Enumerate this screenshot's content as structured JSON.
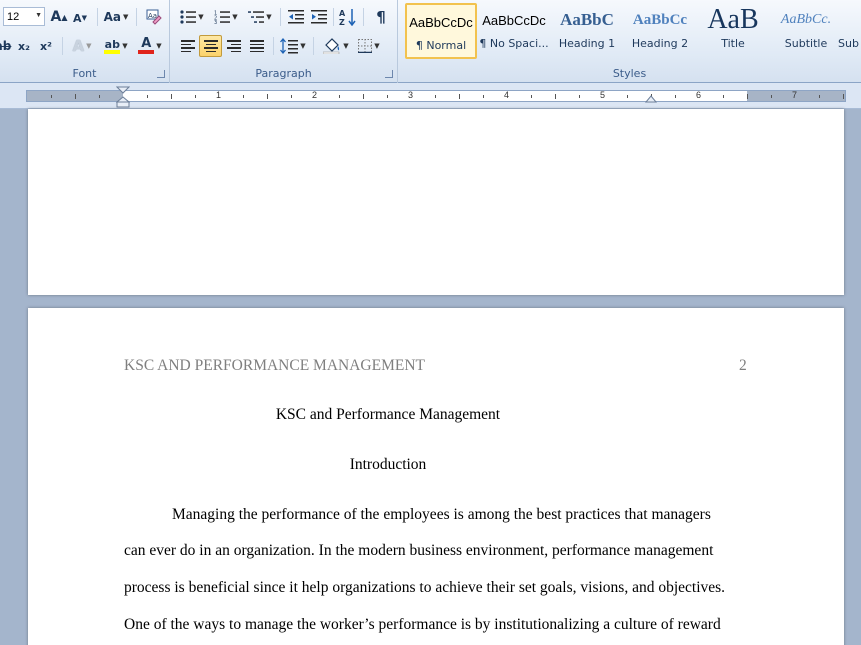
{
  "ribbon": {
    "font_group": {
      "label": "Font",
      "font_size": "12",
      "grow_label": "A",
      "shrink_label": "A",
      "change_case_label": "Aa",
      "subscript_label": "x₂",
      "superscript_label": "x²",
      "font_color_label": "A",
      "font_color": "#e0241b",
      "highlight_color": "#ffff00"
    },
    "paragraph_group": {
      "label": "Paragraph"
    },
    "styles_group": {
      "label": "Styles",
      "styles": [
        {
          "sample": "AaBbCcDc",
          "name": "¶ Normal",
          "selected": true
        },
        {
          "sample": "AaBbCcDc",
          "name": "¶ No Spaci...",
          "selected": false
        },
        {
          "sample": "AaBbC",
          "name": "Heading 1",
          "selected": false
        },
        {
          "sample": "AaBbCc",
          "name": "Heading 2",
          "selected": false
        },
        {
          "sample": "AaB",
          "name": "Title",
          "selected": false
        },
        {
          "sample": "AaBbCc.",
          "name": "Subtitle",
          "selected": false
        },
        {
          "sample": "",
          "name": "Sub",
          "selected": false
        }
      ]
    }
  },
  "ruler": {
    "numbers": [
      "1",
      "2",
      "3",
      "4",
      "5",
      "6",
      "7"
    ]
  },
  "document": {
    "running_head": "KSC AND PERFORMANCE MANAGEMENT",
    "page_number": "2",
    "title": "KSC and Performance Management",
    "heading": "Introduction",
    "paragraph_lines": [
      "Managing the performance of the employees is among the best practices that managers",
      "can ever do in an organization. In the modern business environment, performance management",
      "process is beneficial since it help organizations to achieve their set goals, visions, and objectives.",
      "One of the ways to manage the worker’s performance is by institutionalizing a culture of reward"
    ]
  }
}
